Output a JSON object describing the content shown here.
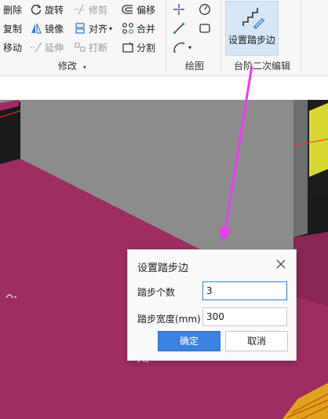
{
  "ribbon": {
    "modify_group": {
      "col1": [
        "删除",
        "复制",
        "移动"
      ],
      "col2": [
        "旋转",
        "镜像",
        "延伸"
      ],
      "col3": [
        "修剪",
        "对齐",
        "打断"
      ],
      "col4": [
        "偏移",
        "合并",
        "分割"
      ],
      "label": "修改"
    },
    "draw_group": {
      "label": "绘图"
    },
    "platform_group": {
      "button_label": "设置踏步边",
      "label": "台阶二次编辑"
    }
  },
  "dialog": {
    "title": "设置踏步边",
    "fields": [
      {
        "label": "踏步个数",
        "value": "3"
      },
      {
        "label": "踏步宽度(mm)",
        "value": "300"
      }
    ],
    "ok_label": "确定",
    "cancel_label": "取消"
  },
  "colors": {
    "accent": "#3b82e0",
    "annotation_arrow": "#e83df0",
    "model_magenta": "#9e2d62",
    "model_yellow": "#d8d833"
  }
}
